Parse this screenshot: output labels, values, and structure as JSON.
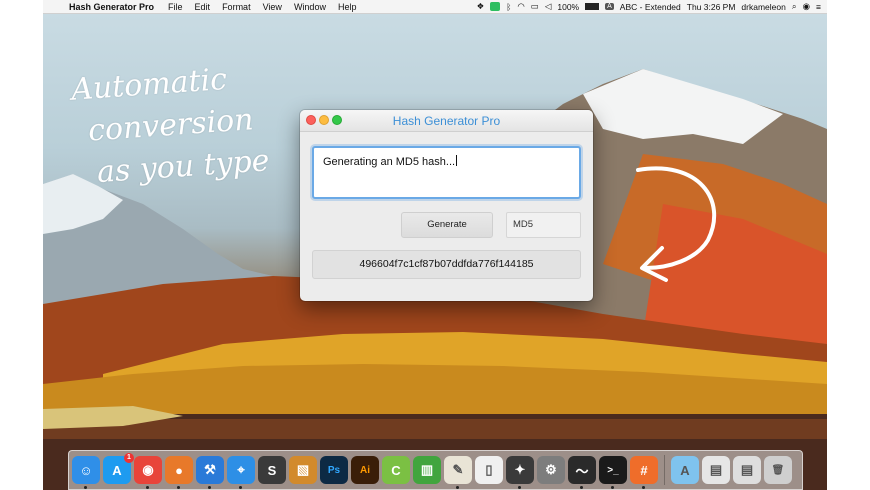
{
  "menubar": {
    "app_name": "Hash Generator Pro",
    "menus": [
      "File",
      "Edit",
      "Format",
      "View",
      "Window",
      "Help"
    ],
    "battery": "100%",
    "input_source": "ABC - Extended",
    "clock": "Thu 3:26 PM",
    "user": "drkameleon"
  },
  "annotation": {
    "handwriting_lines": [
      "Automatic",
      "conversion",
      "as you type"
    ]
  },
  "window": {
    "title": "Hash Generator Pro",
    "input_text": "Generating an MD5 hash...",
    "generate_label": "Generate",
    "algorithm": "MD5",
    "hash_output": "496604f7c1cf87b07ddfda776f144185"
  },
  "dock": {
    "apps": [
      {
        "icon": "finder-icon",
        "glyph": "☺",
        "color": "#2f8fe8"
      },
      {
        "icon": "app-store-icon",
        "glyph": "A",
        "color": "#1e9bf0",
        "badge": "1"
      },
      {
        "icon": "chrome-icon",
        "glyph": "◉",
        "color": "#e8443a"
      },
      {
        "icon": "firefox-icon",
        "glyph": "●",
        "color": "#e8792a"
      },
      {
        "icon": "xcode-icon",
        "glyph": "⚒",
        "color": "#2a7ad8"
      },
      {
        "icon": "maps-icon",
        "glyph": "⌖",
        "color": "#2d8fe6"
      },
      {
        "icon": "sublime-icon",
        "glyph": "S",
        "color": "#3a3a3a"
      },
      {
        "icon": "preview-icon",
        "glyph": "▧",
        "color": "#d28a2c"
      },
      {
        "icon": "photoshop-icon",
        "glyph": "Ps",
        "color": "#0d2a44"
      },
      {
        "icon": "illustrator-icon",
        "glyph": "Ai",
        "color": "#3a1e08"
      },
      {
        "icon": "clipboard-icon",
        "glyph": "C",
        "color": "#7bc043"
      },
      {
        "icon": "numbers-icon",
        "glyph": "▥",
        "color": "#41a53e"
      },
      {
        "icon": "textedit-icon",
        "glyph": "✎",
        "color": "#e9e4d6"
      },
      {
        "icon": "document-icon",
        "glyph": "▯",
        "color": "#f0f0f0"
      },
      {
        "icon": "safari-icon",
        "glyph": "✦",
        "color": "#3a3a3a"
      },
      {
        "icon": "system-preferences-icon",
        "glyph": "⚙",
        "color": "#7d7d7d"
      },
      {
        "icon": "activity-monitor-icon",
        "glyph": "〜",
        "color": "#2a2a2a"
      },
      {
        "icon": "terminal-icon",
        "glyph": ">_",
        "color": "#1a1a1a"
      },
      {
        "icon": "hash-generator-icon",
        "glyph": "#",
        "color": "#ef6d2a"
      },
      {
        "icon": "applications-folder-icon",
        "glyph": "A",
        "color": "#7fc3ee"
      },
      {
        "icon": "downloads-stack-icon",
        "glyph": "▤",
        "color": "#e6e6e6"
      },
      {
        "icon": "documents-stack-icon",
        "glyph": "▤",
        "color": "#dedede"
      },
      {
        "icon": "trash-icon",
        "glyph": "🗑",
        "color": "#cfcfcf"
      }
    ]
  }
}
